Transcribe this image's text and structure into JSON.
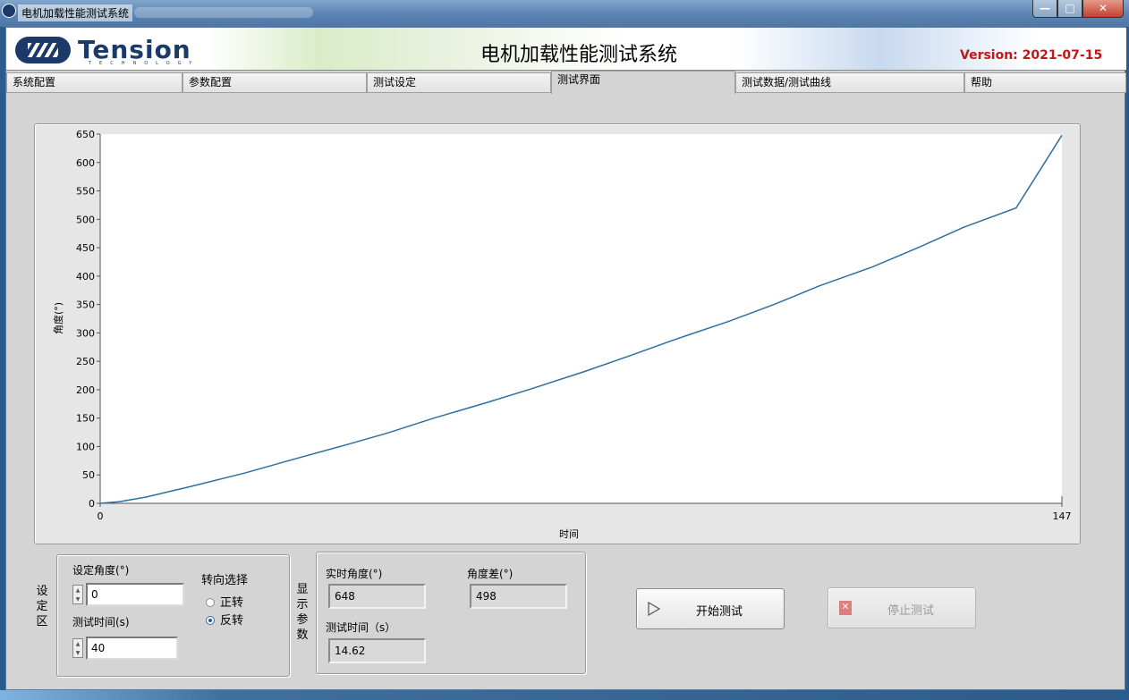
{
  "window": {
    "title": "电机加载性能测试系统",
    "buttons": {
      "minimize": "—",
      "maximize": "□",
      "close": "✕"
    }
  },
  "banner": {
    "logo_word": "Tension",
    "logo_sub": "TECHNOLOGY",
    "app_title": "电机加载性能测试系统",
    "version": "Version: 2021-07-15",
    "version_color": "#c0171b"
  },
  "tabs": [
    {
      "label": "系统配置"
    },
    {
      "label": "参数配置"
    },
    {
      "label": "测试设定"
    },
    {
      "label": "测试界面",
      "active": true
    },
    {
      "label": "测试数据/测试曲线"
    },
    {
      "label": "帮助"
    }
  ],
  "chart_data": {
    "type": "line",
    "title": "",
    "xlabel": "时间",
    "ylabel": "角度(°)",
    "xlim": [
      0,
      147
    ],
    "ylim": [
      0,
      650
    ],
    "x_ticks": [
      "0",
      "147"
    ],
    "y_ticks": [
      "0",
      "50",
      "100",
      "150",
      "200",
      "250",
      "300",
      "350",
      "400",
      "450",
      "500",
      "550",
      "600",
      "650"
    ],
    "grid": false,
    "line_color": "#2e6f9e",
    "series": [
      {
        "x": [
          0,
          3,
          7,
          14,
          22,
          30,
          37,
          44,
          51,
          59,
          66,
          74,
          81,
          88,
          96,
          103,
          110,
          118,
          125,
          132,
          140,
          147
        ],
        "y": [
          0,
          3,
          11,
          30,
          53,
          79,
          101,
          124,
          150,
          177,
          202,
          232,
          260,
          289,
          320,
          350,
          383,
          416,
          450,
          486,
          520,
          648
        ]
      }
    ]
  },
  "settings": {
    "side_label": "设定区",
    "angle_label": "设定角度(°)",
    "angle_value": "0",
    "time_label": "测试时间(s)",
    "time_value": "40",
    "direction_label": "转向选择",
    "direction_options": [
      "正转",
      "反转"
    ],
    "direction_selected": "反转"
  },
  "display": {
    "side_label": "显示参数",
    "realtime_angle_label": "实时角度(°)",
    "realtime_angle_value": "648",
    "angle_diff_label": "角度差(°)",
    "angle_diff_value": "498",
    "test_time_label": "测试时间（s）",
    "test_time_value": "14.62"
  },
  "actions": {
    "start_label": "开始测试",
    "stop_label": "停止测试"
  }
}
